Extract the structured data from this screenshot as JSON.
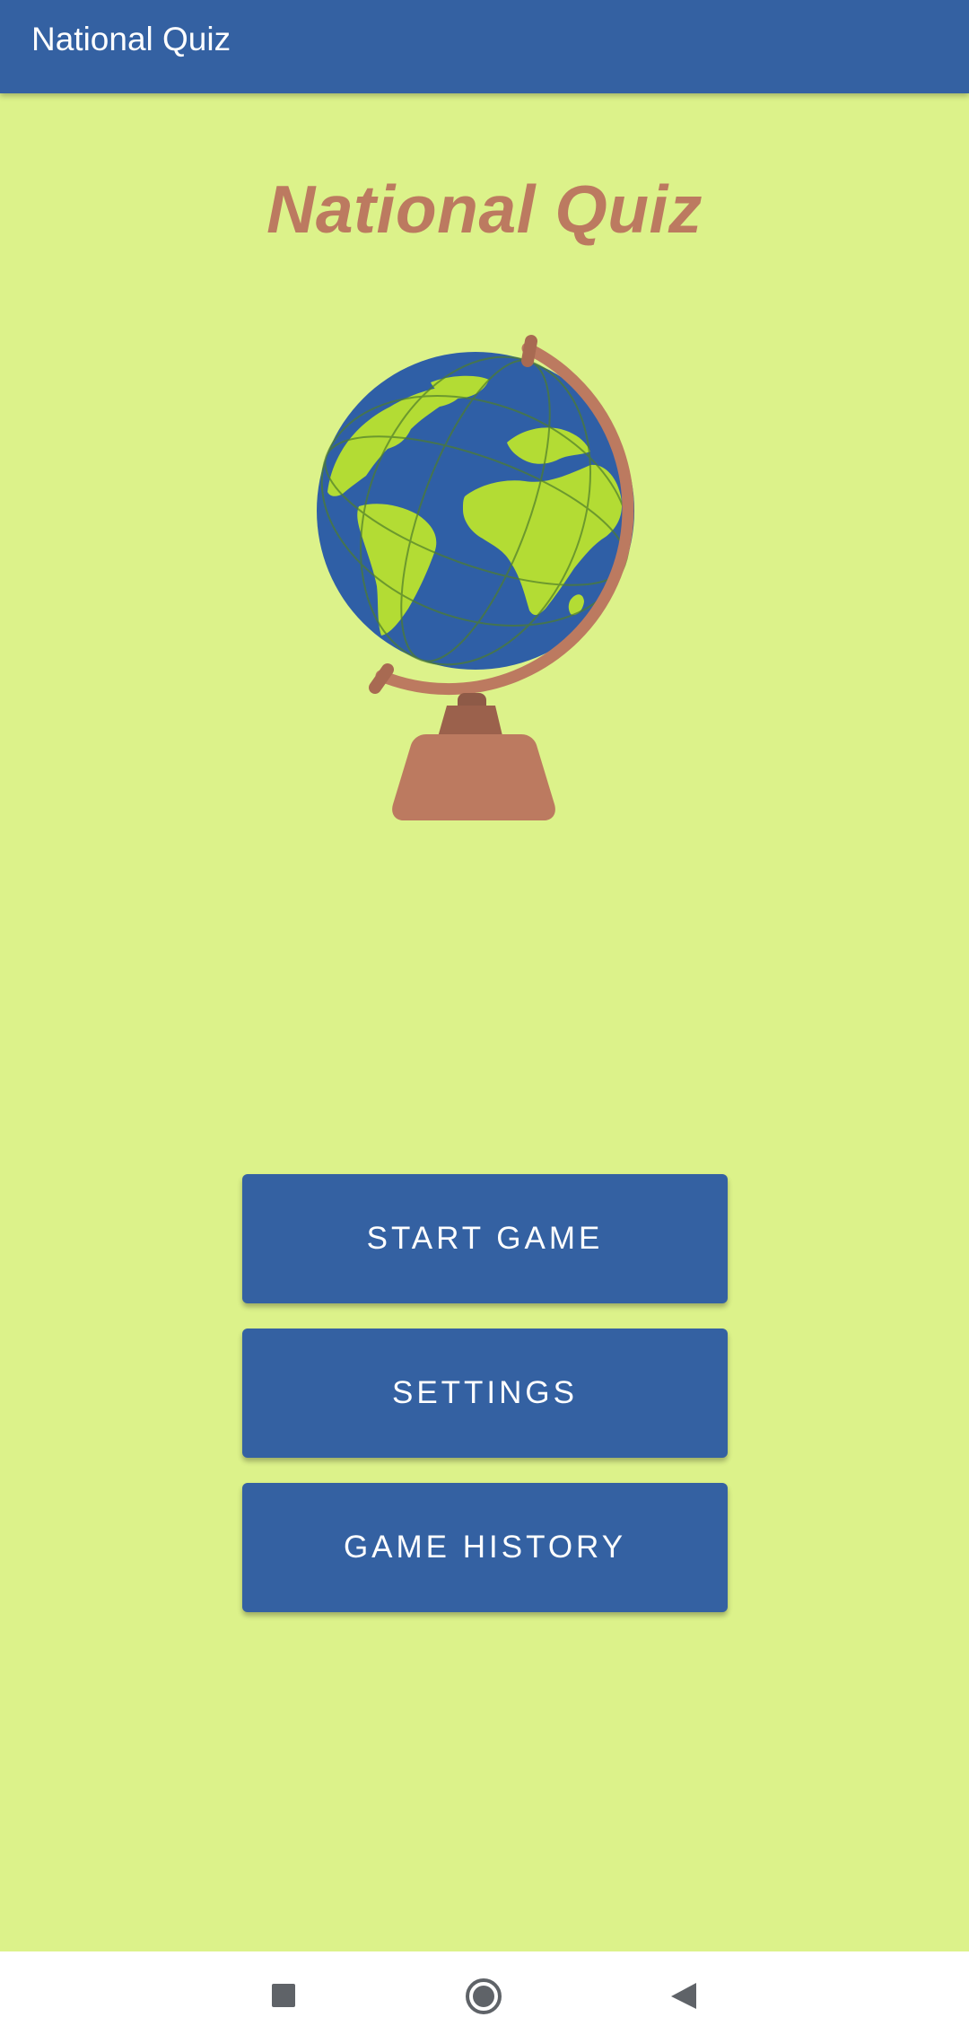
{
  "app_bar": {
    "title": "National Quiz"
  },
  "main": {
    "heading": "National Quiz",
    "illustration": "globe-icon",
    "buttons": {
      "start_game": "START GAME",
      "settings": "SETTINGS",
      "game_history": "GAME HISTORY"
    }
  },
  "nav_bar": {
    "icons": [
      "recents-icon",
      "home-icon",
      "back-icon"
    ]
  },
  "colors": {
    "app_bar": "#3461a2",
    "background": "#dcf28a",
    "heading": "#bc7a60",
    "button": "#3461a2",
    "button_text": "#ffffff",
    "globe_ocean": "#2f5fa6",
    "globe_land": "#b3dc34",
    "globe_stand": "#bc7a60"
  }
}
